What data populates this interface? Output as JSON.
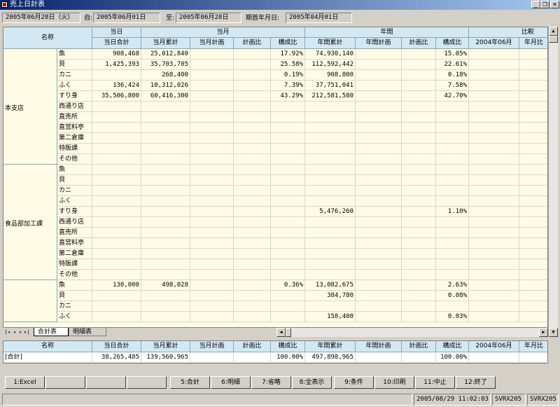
{
  "window": {
    "title": "売上日計表"
  },
  "filters": {
    "date": "2005年06月28日（火）",
    "from_label": "自:",
    "from_value": "2005年06月01日",
    "to_label": "至:",
    "to_value": "2005年06月28日",
    "fy_label": "期首年月日:",
    "fy_value": "2005年04月01日"
  },
  "header": {
    "name": "名称",
    "group_today": "当日",
    "group_month": "当月",
    "group_year": "年間",
    "group_compare": "比較",
    "cols": [
      "当日合計",
      "当月累計",
      "当月計画",
      "計画比",
      "構成比",
      "年間累計",
      "年間計画",
      "計画比",
      "構成比",
      "2004年06月",
      "年月比"
    ]
  },
  "groups": [
    {
      "name": "本支店",
      "rows": [
        {
          "cat": "魚",
          "v": [
            "908,468",
            "25,012,840",
            "",
            "",
            "17.92%",
            "74,930,140",
            "",
            "",
            "15.05%",
            "",
            ""
          ]
        },
        {
          "cat": "貝",
          "v": [
            "1,425,393",
            "35,703,705",
            "",
            "",
            "25.58%",
            "112,592,442",
            "",
            "",
            "22.61%",
            "",
            ""
          ]
        },
        {
          "cat": "カニ",
          "v": [
            "",
            "268,400",
            "",
            "",
            "0.19%",
            "908,800",
            "",
            "",
            "0.18%",
            "",
            ""
          ]
        },
        {
          "cat": "ふく",
          "v": [
            "136,424",
            "10,312,026",
            "",
            "",
            "7.39%",
            "37,751,041",
            "",
            "",
            "7.58%",
            "",
            ""
          ]
        },
        {
          "cat": "すり身",
          "v": [
            "35,506,800",
            "60,416,300",
            "",
            "",
            "43.29%",
            "212,581,580",
            "",
            "",
            "42.70%",
            "",
            ""
          ]
        },
        {
          "cat": "西通り店",
          "v": [
            "",
            "",
            "",
            "",
            "",
            "",
            "",
            "",
            "",
            "",
            ""
          ]
        },
        {
          "cat": "直売所",
          "v": [
            "",
            "",
            "",
            "",
            "",
            "",
            "",
            "",
            "",
            "",
            ""
          ]
        },
        {
          "cat": "直営料亭",
          "v": [
            "",
            "",
            "",
            "",
            "",
            "",
            "",
            "",
            "",
            "",
            ""
          ]
        },
        {
          "cat": "第二倉庫",
          "v": [
            "",
            "",
            "",
            "",
            "",
            "",
            "",
            "",
            "",
            "",
            ""
          ]
        },
        {
          "cat": "特販課",
          "v": [
            "",
            "",
            "",
            "",
            "",
            "",
            "",
            "",
            "",
            "",
            ""
          ]
        },
        {
          "cat": "その他",
          "v": [
            "",
            "",
            "",
            "",
            "",
            "",
            "",
            "",
            "",
            "",
            ""
          ]
        }
      ]
    },
    {
      "name": "食品部加工課",
      "rows": [
        {
          "cat": "魚",
          "v": [
            "",
            "",
            "",
            "",
            "",
            "",
            "",
            "",
            "",
            "",
            ""
          ]
        },
        {
          "cat": "貝",
          "v": [
            "",
            "",
            "",
            "",
            "",
            "",
            "",
            "",
            "",
            "",
            ""
          ]
        },
        {
          "cat": "カニ",
          "v": [
            "",
            "",
            "",
            "",
            "",
            "",
            "",
            "",
            "",
            "",
            ""
          ]
        },
        {
          "cat": "ふく",
          "v": [
            "",
            "",
            "",
            "",
            "",
            "",
            "",
            "",
            "",
            "",
            ""
          ]
        },
        {
          "cat": "すり身",
          "v": [
            "",
            "",
            "",
            "",
            "",
            "5,476,260",
            "",
            "",
            "1.10%",
            "",
            ""
          ]
        },
        {
          "cat": "西通り店",
          "v": [
            "",
            "",
            "",
            "",
            "",
            "",
            "",
            "",
            "",
            "",
            ""
          ]
        },
        {
          "cat": "直売所",
          "v": [
            "",
            "",
            "",
            "",
            "",
            "",
            "",
            "",
            "",
            "",
            ""
          ]
        },
        {
          "cat": "直営料亭",
          "v": [
            "",
            "",
            "",
            "",
            "",
            "",
            "",
            "",
            "",
            "",
            ""
          ]
        },
        {
          "cat": "第二倉庫",
          "v": [
            "",
            "",
            "",
            "",
            "",
            "",
            "",
            "",
            "",
            "",
            ""
          ]
        },
        {
          "cat": "特販課",
          "v": [
            "",
            "",
            "",
            "",
            "",
            "",
            "",
            "",
            "",
            "",
            ""
          ]
        },
        {
          "cat": "その他",
          "v": [
            "",
            "",
            "",
            "",
            "",
            "",
            "",
            "",
            "",
            "",
            ""
          ]
        }
      ]
    },
    {
      "name": "",
      "rows": [
        {
          "cat": "魚",
          "v": [
            "130,000",
            "498,028",
            "",
            "",
            "0.36%",
            "13,082,675",
            "",
            "",
            "2.63%",
            "",
            ""
          ]
        },
        {
          "cat": "貝",
          "v": [
            "",
            "",
            "",
            "",
            "",
            "384,780",
            "",
            "",
            "0.08%",
            "",
            ""
          ]
        },
        {
          "cat": "カニ",
          "v": [
            "",
            "",
            "",
            "",
            "",
            "",
            "",
            "",
            "",
            "",
            ""
          ]
        },
        {
          "cat": "ふく",
          "v": [
            "",
            "",
            "",
            "",
            "",
            "158,400",
            "",
            "",
            "0.03%",
            "",
            ""
          ]
        }
      ]
    }
  ],
  "tabs": [
    "合計表",
    "明細表"
  ],
  "summary": {
    "headers": [
      "名称",
      "当日合計",
      "当月累計",
      "当月計画",
      "計画比",
      "構成比",
      "年間累計",
      "年間計画",
      "計画比",
      "構成比",
      "2004年06月",
      "年月比"
    ],
    "row": [
      "[合計]",
      "38,265,485",
      "139,560,965",
      "",
      "",
      "100.00%",
      "497,898,965",
      "",
      "",
      "100.00%",
      "",
      ""
    ]
  },
  "buttons": [
    "1:Excel",
    "",
    "",
    "",
    "5:合計",
    "6:明細",
    "7:省略",
    "8:全表示",
    "9:条件",
    "10:印刷",
    "11:中止",
    "12:終了"
  ],
  "status": {
    "datetime": "2005/08/29 11:02:03",
    "user1": "SVRX205",
    "user2": "SVRX205"
  },
  "colors": {
    "header_bg": "#d4e8f4",
    "cell_bg": "#fffbe6",
    "title_bar": "#0a246a"
  }
}
